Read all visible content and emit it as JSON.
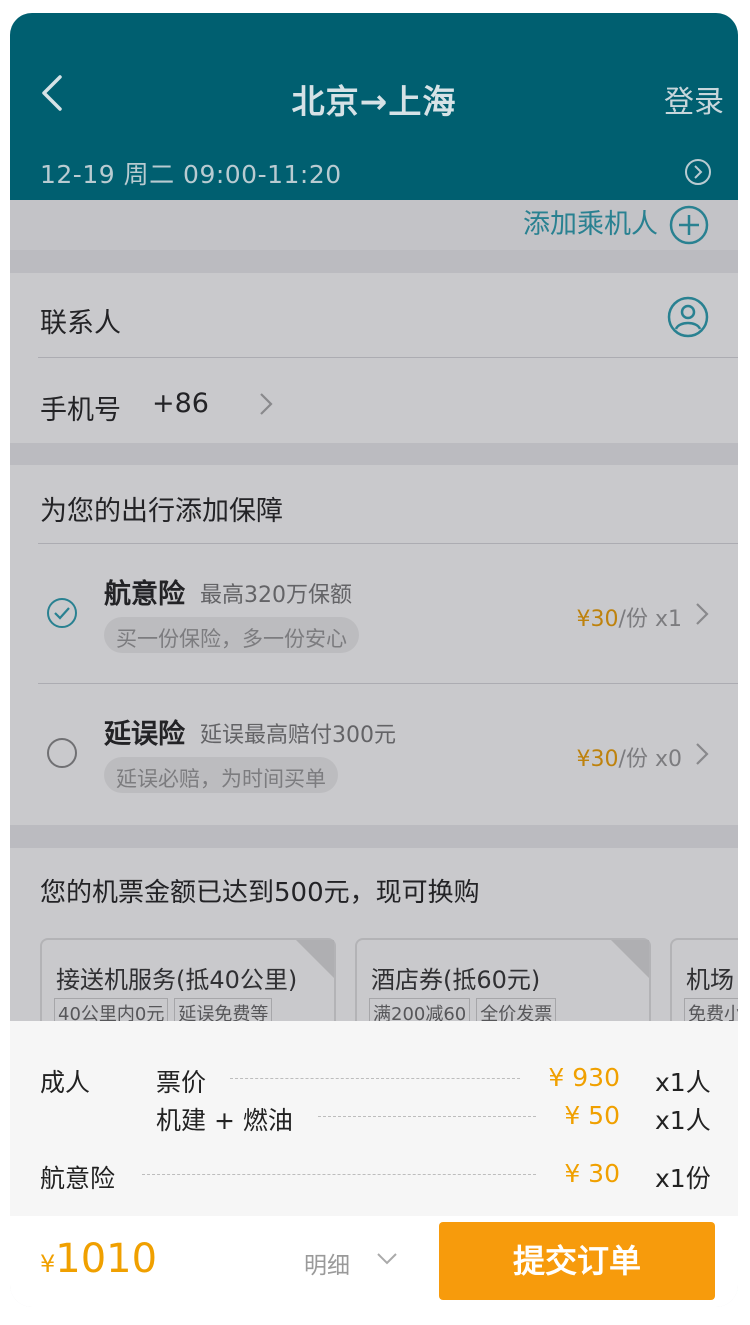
{
  "header": {
    "title": "北京→上海",
    "login_label": "登录",
    "flight_info": "12-19  周二  09:00-11:20"
  },
  "passenger": {
    "add_label": "添加乘机人"
  },
  "contact": {
    "label": "联系人",
    "phone_label": "手机号",
    "phone_code": "+86"
  },
  "insurance": {
    "title": "为您的出行添加保障",
    "items": [
      {
        "name": "航意险",
        "desc": "最高320万保额",
        "tag": "买一份保险，多一份安心",
        "price": "¥30",
        "unit": "/份",
        "qty": "x1",
        "checked": true
      },
      {
        "name": "延误险",
        "desc": "延误最高赔付300元",
        "tag": "延误必赔，为时间买单",
        "price": "¥30",
        "unit": "/份",
        "qty": "x0",
        "checked": false
      }
    ]
  },
  "upgrade": {
    "title": "您的机票金额已达到500元，现可换购",
    "coupons": [
      {
        "title": "接送机服务(抵40公里)",
        "tags": [
          "40公里内0元",
          "延误免费等"
        ]
      },
      {
        "title": "酒店券(抵60元)",
        "tags": [
          "满200减60",
          "全价发票"
        ]
      },
      {
        "title": "机场",
        "tags": [
          "免费小"
        ]
      }
    ]
  },
  "price_detail": {
    "adult_label": "成人",
    "ticket_label": "票价",
    "ticket_price": "¥ 930",
    "ticket_qty": "x1人",
    "tax_label": "机建 + 燃油",
    "tax_price": "¥ 50",
    "tax_qty": "x1人",
    "insurance_label": "航意险",
    "insurance_price": "¥ 30",
    "insurance_qty": "x1份"
  },
  "footer": {
    "currency": "¥",
    "total": "1010",
    "detail_label": "明细",
    "submit_label": "提交订单"
  },
  "colors": {
    "header_bg": "#005f70",
    "accent_orange": "#f79b0c",
    "price_orange": "#f0a000",
    "teal_icon": "#2a9fb0"
  }
}
